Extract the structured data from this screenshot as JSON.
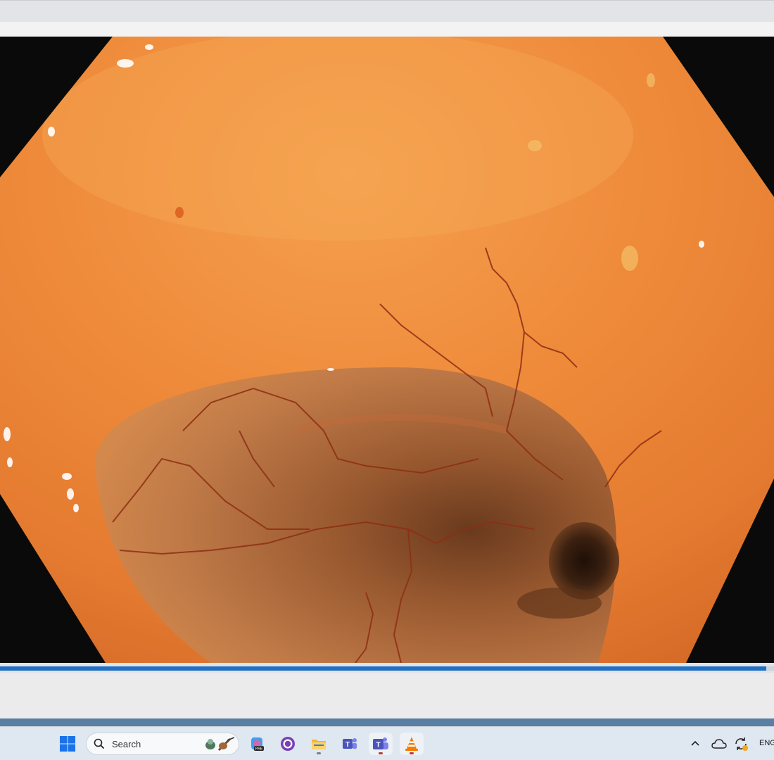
{
  "taskbar": {
    "search_placeholder": "Search",
    "language": "ENG",
    "apps": [
      "windows-start",
      "copilot-preview",
      "github-desktop",
      "file-explorer",
      "microsoft-teams-classic",
      "microsoft-teams",
      "vlc-media-player"
    ]
  },
  "player": {
    "seek_progress": 0.99
  },
  "colors": {
    "accent": "#1f6fc2",
    "taskbar": "#dfe7f0",
    "video_background": "#0a0a0a"
  }
}
